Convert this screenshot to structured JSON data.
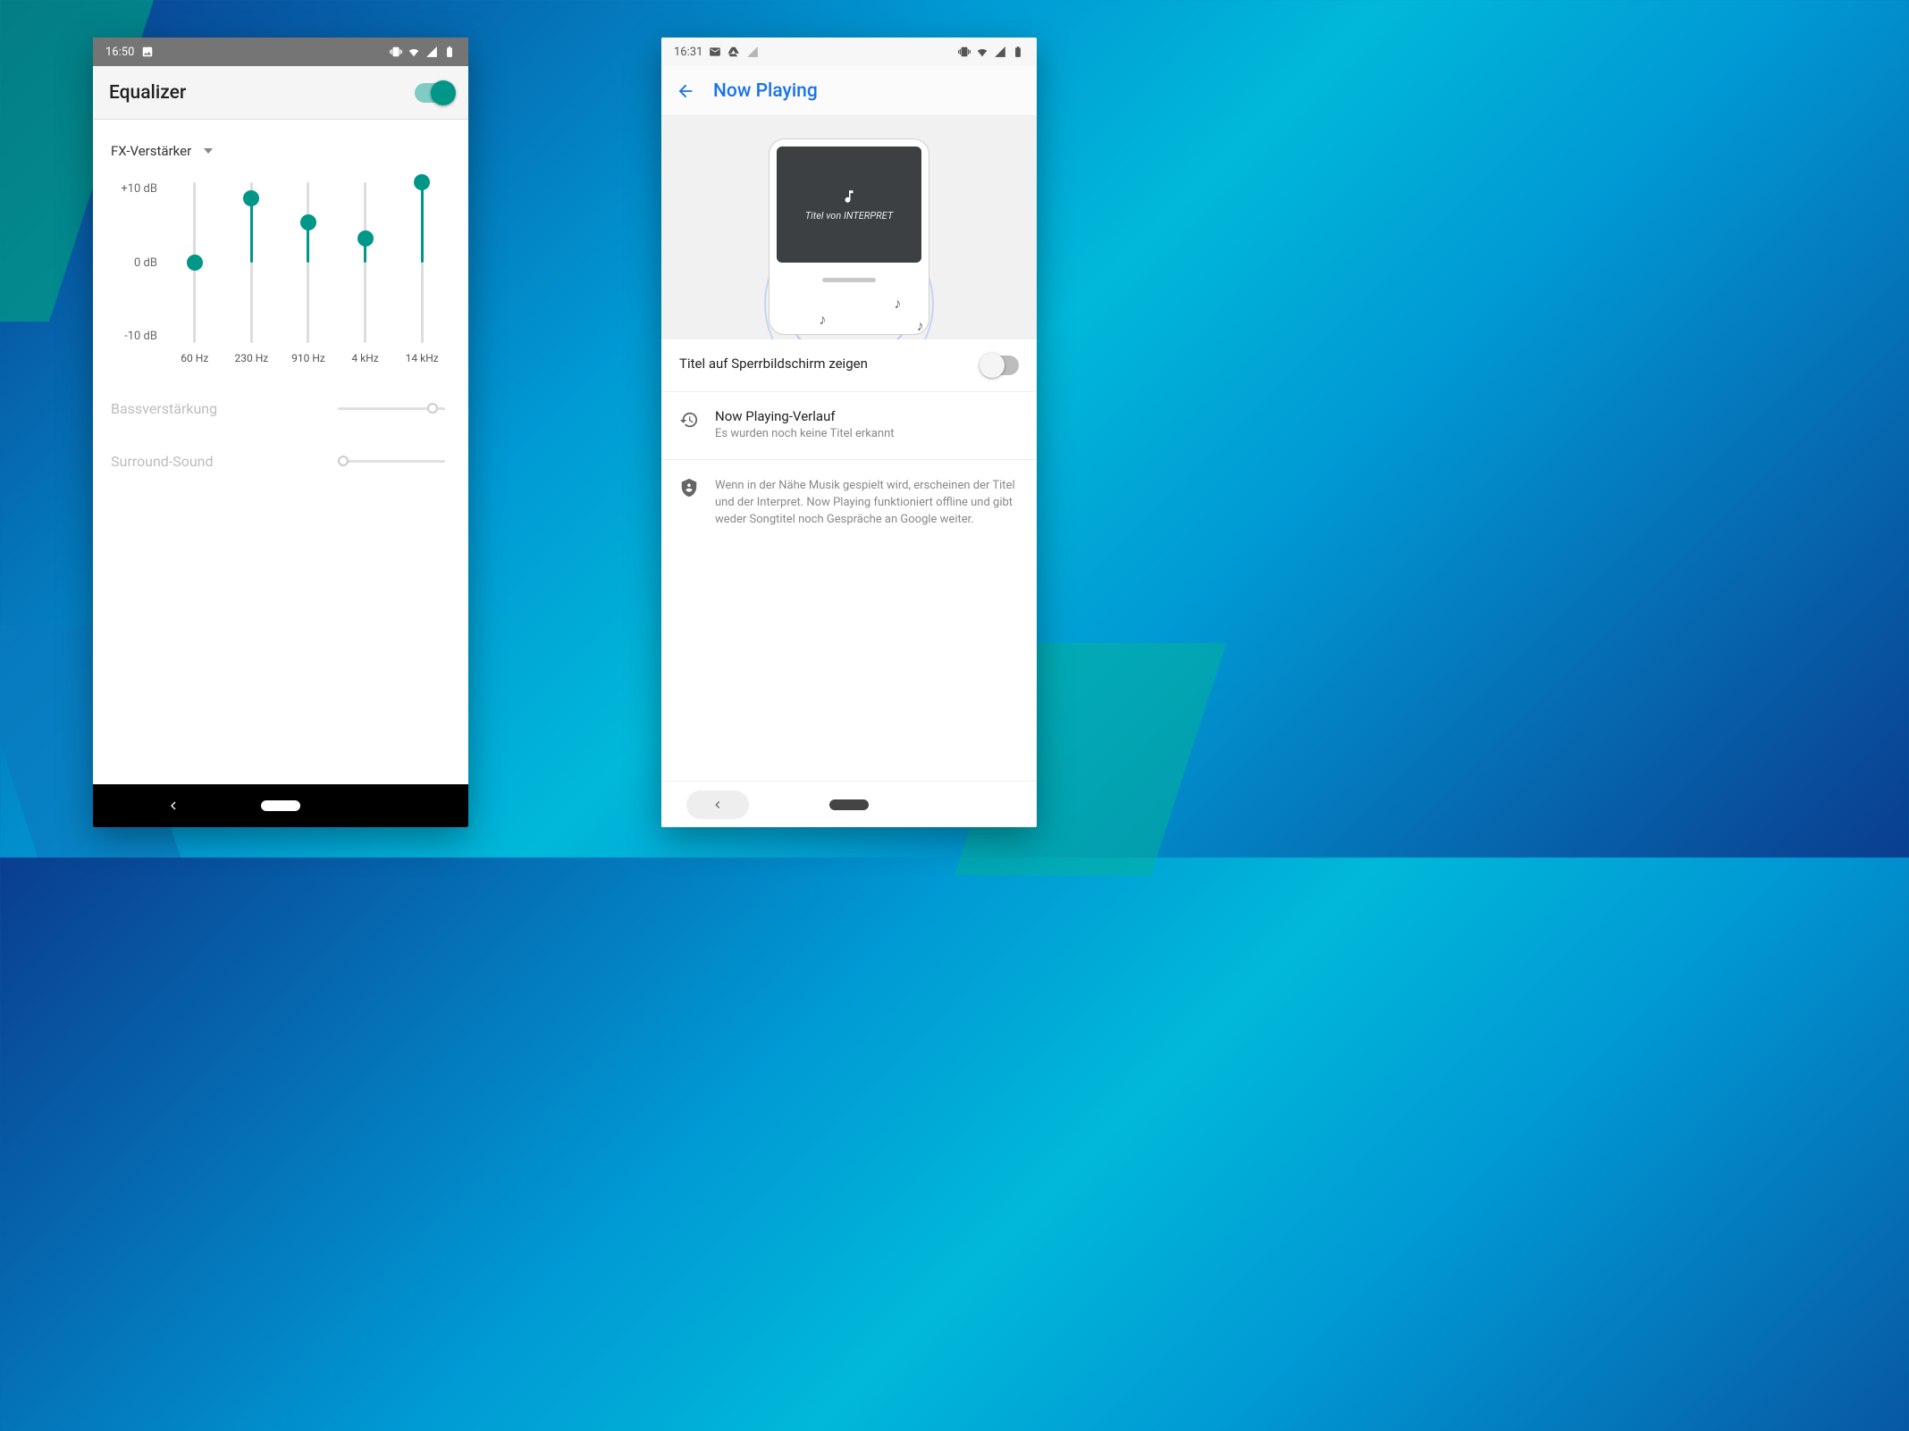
{
  "left": {
    "status": {
      "time": "16:50"
    },
    "title": "Equalizer",
    "toggle_on": true,
    "preset": "FX-Verstärker",
    "y_labels": [
      "+10 dB",
      "0 dB",
      "-10 dB"
    ],
    "bands": [
      {
        "freq": "60 Hz",
        "db": 0
      },
      {
        "freq": "230 Hz",
        "db": 8
      },
      {
        "freq": "910 Hz",
        "db": 5
      },
      {
        "freq": "4 kHz",
        "db": 3
      },
      {
        "freq": "14 kHz",
        "db": 10
      }
    ],
    "bass_label": "Bassverstärkung",
    "surround_label": "Surround-Sound"
  },
  "right": {
    "status": {
      "time": "16:31"
    },
    "title": "Now Playing",
    "hero_track_line": "Titel von INTERPRET",
    "lock_toggle_label": "Titel auf Sperrbildschirm zeigen",
    "lock_toggle_on": false,
    "history_title": "Now Playing-Verlauf",
    "history_sub": "Es wurden noch keine Titel erkannt",
    "info_text": "Wenn in der Nähe Musik gespielt wird, erscheinen der Titel und der Interpret. Now Playing funktioniert offline und gibt weder Songtitel noch Gespräche an Google weiter."
  }
}
